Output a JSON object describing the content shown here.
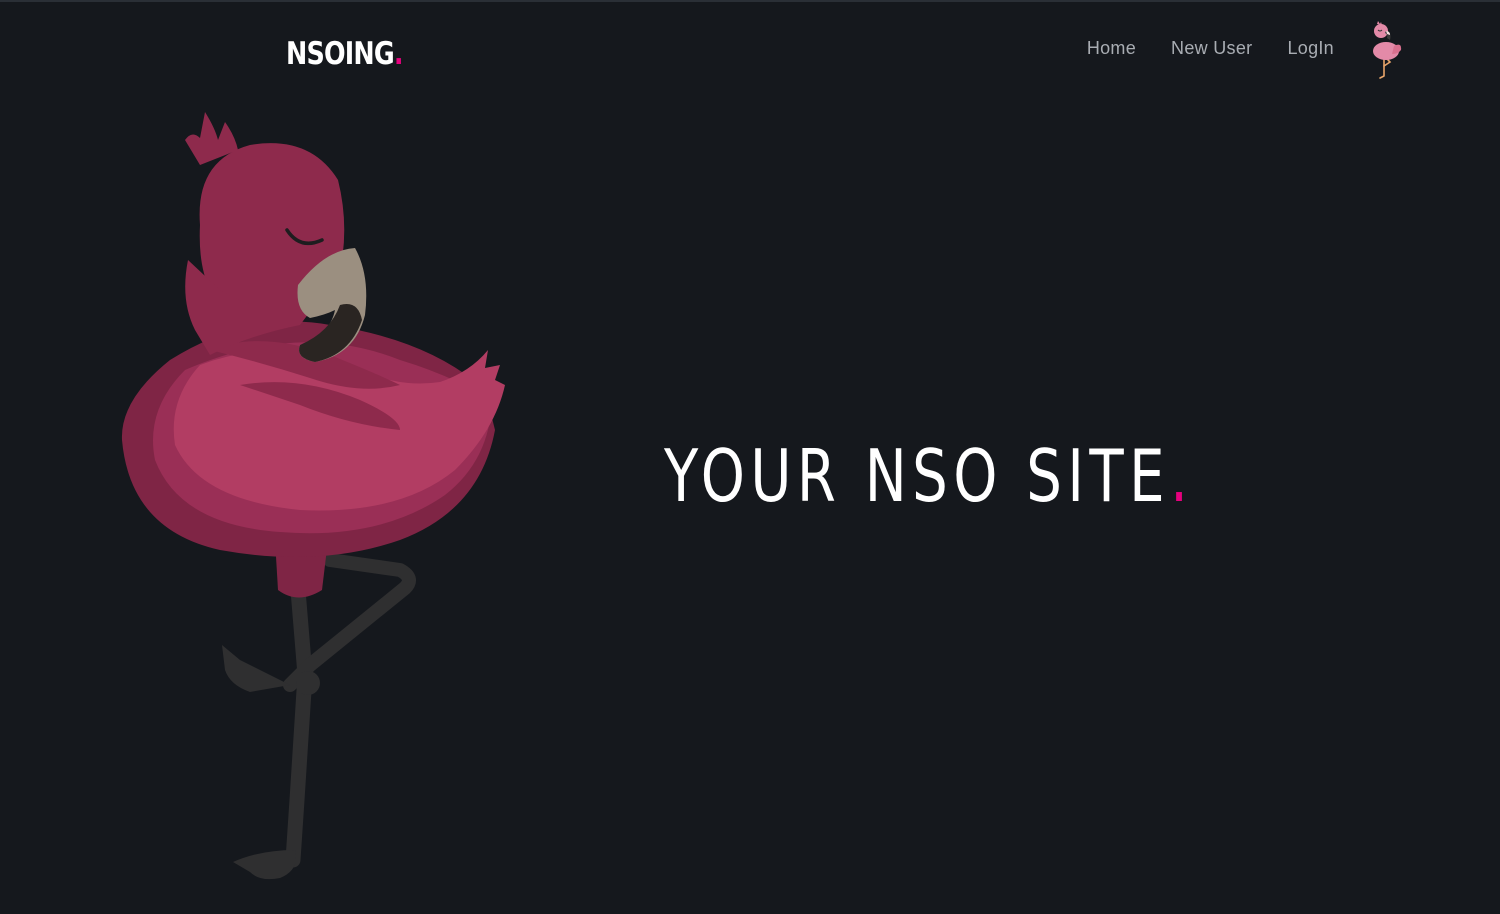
{
  "header": {
    "brand": "NSOING",
    "brand_dot": ".",
    "nav": {
      "home": "Home",
      "new_user": "New User",
      "login": "LogIn"
    },
    "avatar_icon": "flamingo-icon"
  },
  "hero": {
    "title": "YOUR NSO SITE",
    "title_dot": ".",
    "illustration": "flamingo-illustration"
  },
  "colors": {
    "background": "#15181d",
    "accent": "#e6007e",
    "nav_text": "#a9adb3",
    "title_text": "#ffffff"
  }
}
